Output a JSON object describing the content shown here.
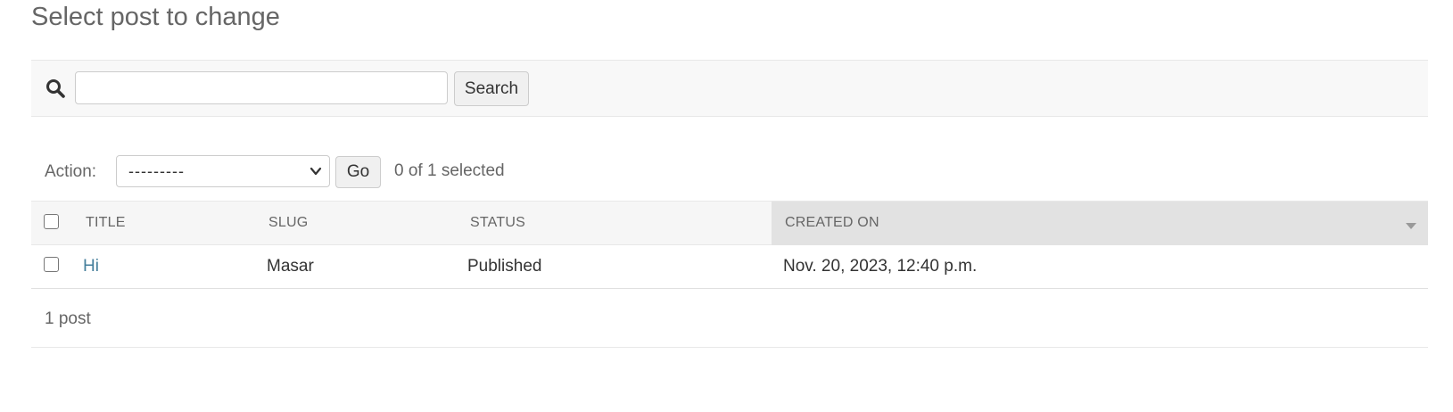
{
  "page": {
    "title": "Select post to change"
  },
  "search": {
    "value": "",
    "placeholder": "",
    "button_label": "Search",
    "icon": "search-icon"
  },
  "actions": {
    "label": "Action:",
    "selected_option": "---------",
    "go_label": "Go",
    "selection_count": "0 of 1 selected"
  },
  "table": {
    "columns": [
      {
        "label": "TITLE"
      },
      {
        "label": "SLUG"
      },
      {
        "label": "STATUS"
      },
      {
        "label": "CREATED ON",
        "sorted": "descending"
      }
    ],
    "rows": [
      {
        "title": "Hi",
        "slug": "Masar",
        "status": "Published",
        "created_on": "Nov. 20, 2023, 12:40 p.m.",
        "checked": false
      }
    ]
  },
  "paginator": {
    "text": "1 post"
  },
  "colors": {
    "link": "#447e9b",
    "toolbar_bg": "#f8f8f8",
    "sorted_header_bg": "#e2e2e2"
  }
}
